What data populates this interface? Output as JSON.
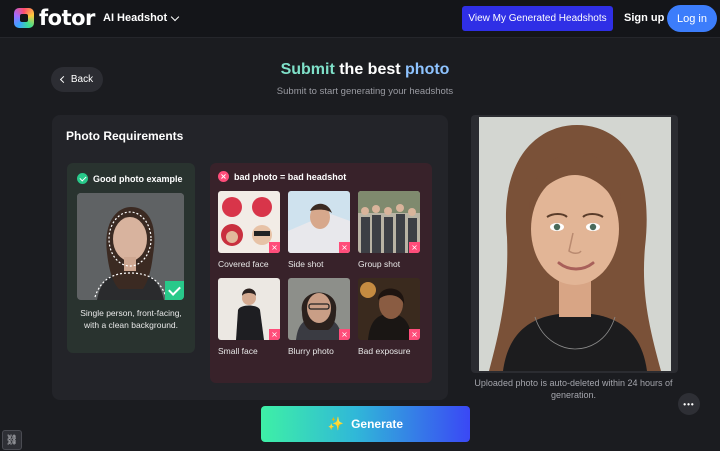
{
  "header": {
    "logo_text": "fotor",
    "menu_label": "AI Headshot",
    "view_headshots_label": "View My Generated Headshots",
    "signup_label": "Sign up",
    "login_label": "Log in"
  },
  "nav": {
    "back_label": "Back"
  },
  "hero": {
    "title_part1": "Submit",
    "title_part2": " the best ",
    "title_part3": "photo",
    "subtitle": "Submit to start generating your headshots"
  },
  "requirements": {
    "title": "Photo Requirements",
    "good": {
      "heading": "Good photo example",
      "caption": "Single person, front-facing, with a clean background."
    },
    "bad": {
      "heading": "bad photo = bad headshot",
      "items": [
        {
          "label": "Covered face"
        },
        {
          "label": "Side shot"
        },
        {
          "label": "Group shot"
        },
        {
          "label": "Small face"
        },
        {
          "label": "Blurry photo"
        },
        {
          "label": "Bad exposure"
        }
      ]
    }
  },
  "upload": {
    "note": "Uploaded photo is auto-deleted within 24 hours of generation."
  },
  "actions": {
    "generate_label": "Generate",
    "more_label": "•••"
  },
  "colors": {
    "accent_blue": "#2f2fe6",
    "login_blue": "#3c7dfb",
    "good_green": "#28c98a",
    "bad_pink": "#ff4d7a"
  }
}
